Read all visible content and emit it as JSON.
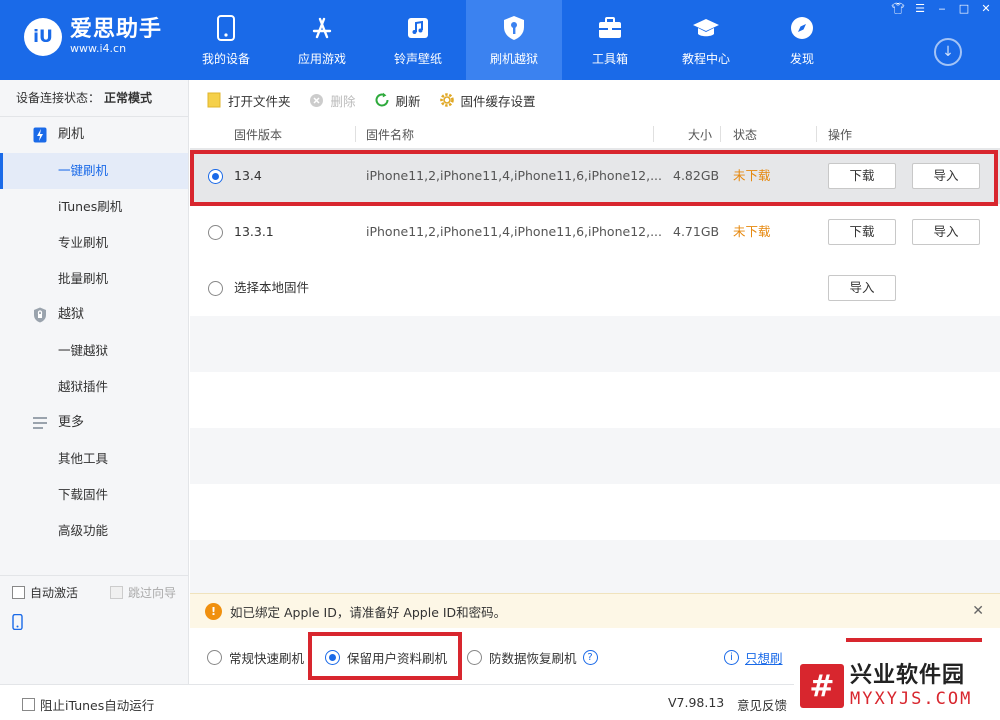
{
  "app": {
    "logo_badge": "iU",
    "logo_name": "爱思助手",
    "logo_url": "www.i4.cn"
  },
  "nav": [
    {
      "label": "我的设备",
      "icon": "phone-icon"
    },
    {
      "label": "应用游戏",
      "icon": "app-store-icon"
    },
    {
      "label": "铃声壁纸",
      "icon": "music-icon"
    },
    {
      "label": "刷机越狱",
      "icon": "shield-key-icon",
      "active": true
    },
    {
      "label": "工具箱",
      "icon": "toolbox-icon"
    },
    {
      "label": "教程中心",
      "icon": "graduation-cap-icon"
    },
    {
      "label": "发现",
      "icon": "compass-icon"
    }
  ],
  "window_controls": [
    "shirt-icon",
    "menu-icon",
    "minimize-icon",
    "maximize-icon",
    "close-icon"
  ],
  "sidebar": {
    "conn_label": "设备连接状态：",
    "conn_value": "正常模式",
    "groups": [
      {
        "label": "刷机",
        "icon": "flash-icon",
        "items": [
          "一键刷机",
          "iTunes刷机",
          "专业刷机",
          "批量刷机"
        ]
      },
      {
        "label": "越狱",
        "icon": "shield-lock-icon",
        "items": [
          "一键越狱",
          "越狱插件"
        ]
      },
      {
        "label": "更多",
        "icon": "list-icon",
        "items": [
          "其他工具",
          "下载固件",
          "高级功能"
        ]
      }
    ],
    "active_item": "一键刷机",
    "auto_activate": "自动激活",
    "skip_guide": "跳过向导"
  },
  "toolbar": {
    "open_folder": "打开文件夹",
    "delete": "删除",
    "refresh": "刷新",
    "cache_settings": "固件缓存设置"
  },
  "table": {
    "headers": {
      "version": "固件版本",
      "name": "固件名称",
      "size": "大小",
      "status": "状态",
      "action": "操作"
    },
    "rows": [
      {
        "version": "13.4",
        "name": "iPhone11,2,iPhone11,4,iPhone11,6,iPhone12,...",
        "size": "4.82GB",
        "status": "未下载",
        "download": "下载",
        "import": "导入",
        "selected": true
      },
      {
        "version": "13.3.1",
        "name": "iPhone11,2,iPhone11,4,iPhone11,6,iPhone12,...",
        "size": "4.71GB",
        "status": "未下载",
        "download": "下载",
        "import": "导入",
        "selected": false
      }
    ],
    "local": {
      "label": "选择本地固件",
      "import": "导入"
    }
  },
  "notice": {
    "text": "如已绑定 Apple ID，请准备好 Apple ID和密码。",
    "close": "✕"
  },
  "modes": {
    "quick": "常规快速刷机",
    "keep_data": "保留用户资料刷机",
    "anti_recovery": "防数据恢复刷机",
    "help": "?",
    "info_icon": "i",
    "info_link": "只想刷"
  },
  "statusbar": {
    "block_itunes": "阻止iTunes自动运行",
    "version": "V7.98.13",
    "feedback": "意见反馈"
  },
  "watermark": {
    "logo": "#",
    "cn": "兴业软件园",
    "en": "MYXYJS.COM"
  },
  "colors": {
    "header": "#1a6ae8",
    "accent": "#1a6ae8",
    "status": "#e6880e",
    "highlight_box": "#d8262e"
  }
}
